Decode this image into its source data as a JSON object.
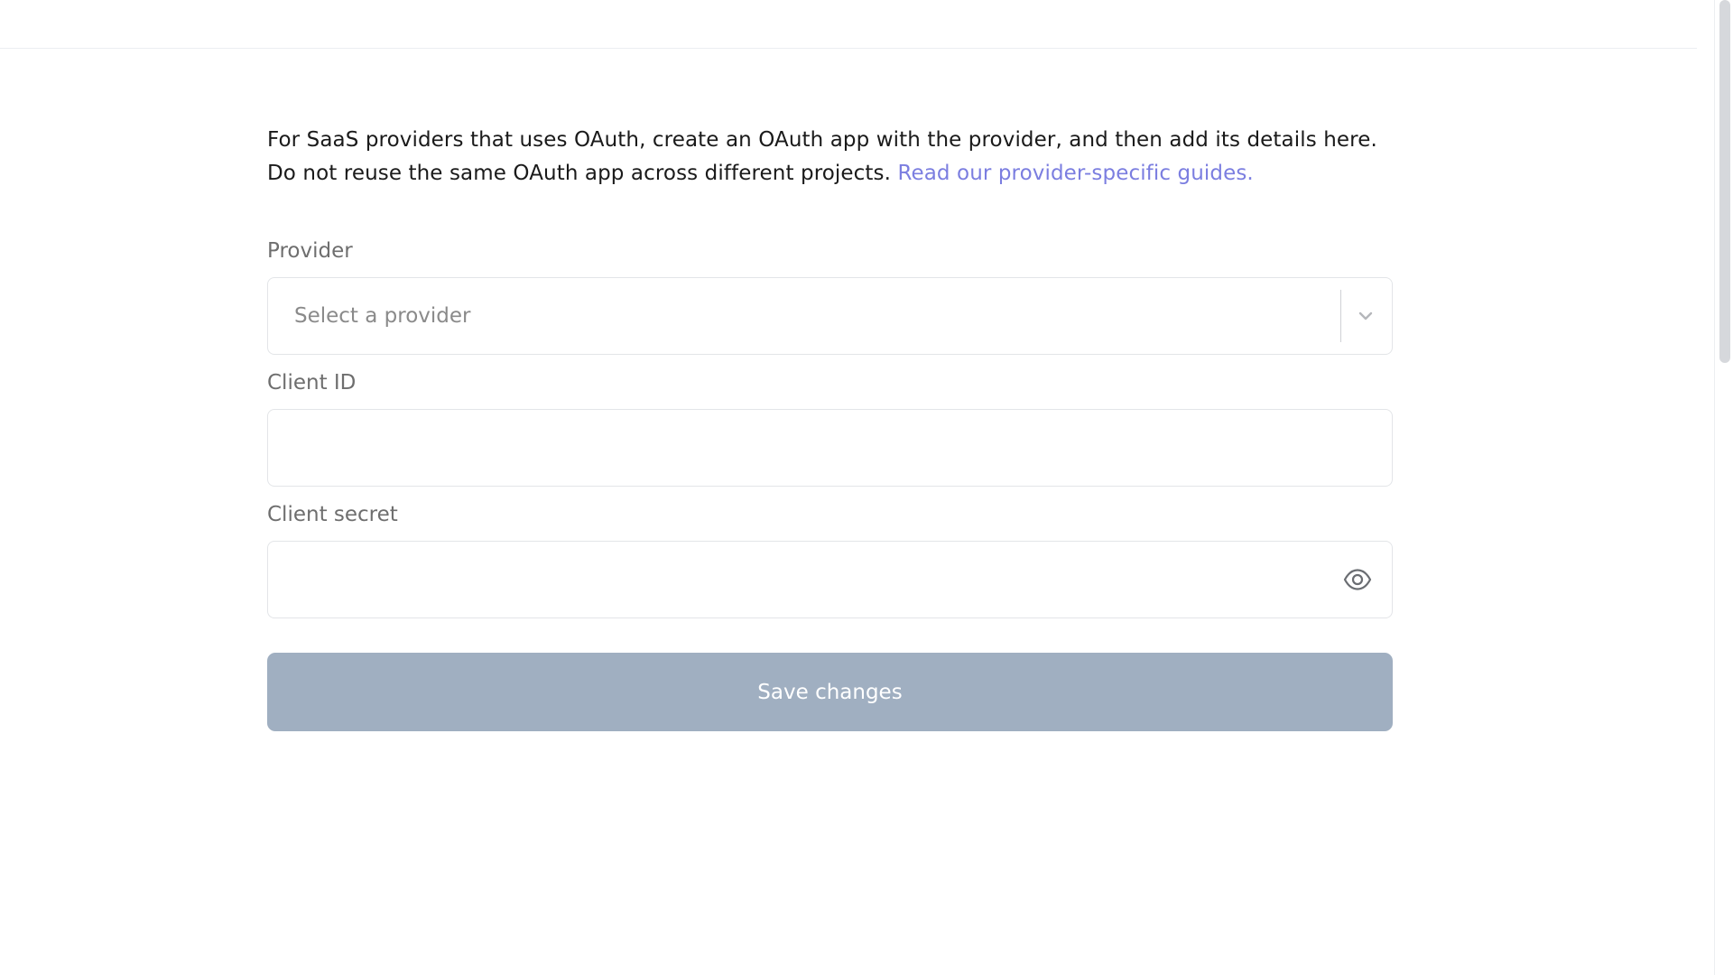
{
  "intro": {
    "text": "For SaaS providers that uses OAuth, create an OAuth app with the provider, and then add its details here. Do not reuse the same OAuth app across different projects. ",
    "link_text": "Read our provider-specific guides."
  },
  "provider": {
    "label": "Provider",
    "placeholder": "Select a provider",
    "chevron_icon": "chevron-down-icon"
  },
  "client_id": {
    "label": "Client ID",
    "value": ""
  },
  "client_secret": {
    "label": "Client secret",
    "value": "",
    "toggle_icon": "eye-icon"
  },
  "save": {
    "label": "Save changes"
  },
  "colors": {
    "link": "#7b7ee0",
    "button_bg": "#a0afc1",
    "button_text": "#ffffff",
    "label": "#6e6e6e",
    "border": "#e3e5e8"
  }
}
